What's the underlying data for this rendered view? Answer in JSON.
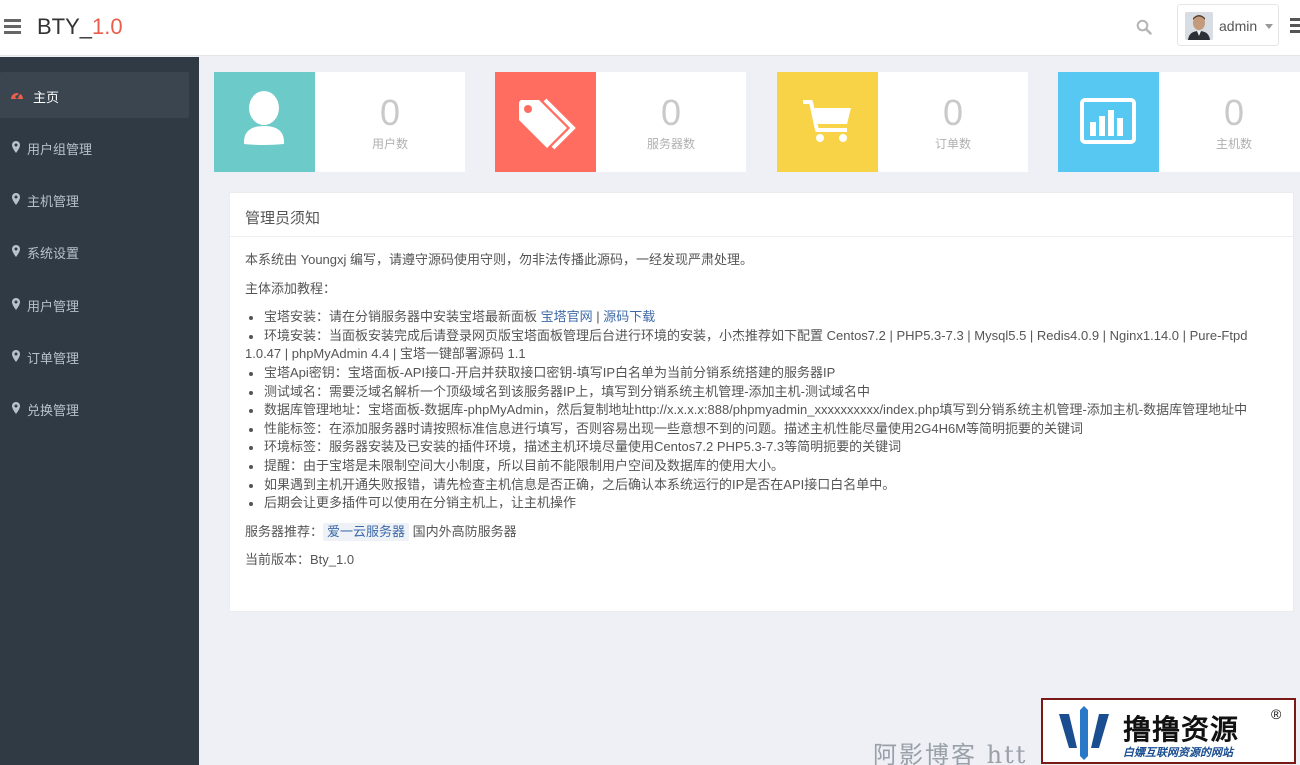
{
  "header": {
    "brand_prefix": "BTY_",
    "brand_version": "1.0",
    "user_name": "admin"
  },
  "sidebar": {
    "items": [
      {
        "label": "主页",
        "icon": "dashboard-icon",
        "active": true
      },
      {
        "label": "用户组管理",
        "icon": "map-marker-icon"
      },
      {
        "label": "主机管理",
        "icon": "map-marker-icon"
      },
      {
        "label": "系统设置",
        "icon": "map-marker-icon"
      },
      {
        "label": "用户管理",
        "icon": "map-marker-icon"
      },
      {
        "label": "订单管理",
        "icon": "map-marker-icon"
      },
      {
        "label": "兑换管理",
        "icon": "map-marker-icon"
      }
    ]
  },
  "stats": [
    {
      "value": "0",
      "label": "用户数",
      "icon": "user-icon",
      "color": "#6ccac9"
    },
    {
      "value": "0",
      "label": "服务器数",
      "icon": "tags-icon",
      "color": "#ff6c60"
    },
    {
      "value": "0",
      "label": "订单数",
      "icon": "shopping-cart-icon",
      "color": "#f8d347"
    },
    {
      "value": "0",
      "label": "主机数",
      "icon": "bar-chart-icon",
      "color": "#57c8f2"
    }
  ],
  "notice": {
    "title": "管理员须知",
    "intro": "本系统由 Youngxj 编写，请遵守源码使用守则，勿非法传播此源码，一经发现严肃处理。",
    "subtitle": "主体添加教程：",
    "item1_text": "宝塔安装：请在分销服务器中安装宝塔最新面板 ",
    "item1_link1": "宝塔官网",
    "item1_sep": " | ",
    "item1_link2": "源码下载",
    "item2": "环境安装：当面板安装完成后请登录网页版宝塔面板管理后台进行环境的安装，小杰推荐如下配置 Centos7.2 | PHP5.3-7.3 | Mysql5.5 | Redis4.0.9 | Nginx1.14.0 | Pure-Ftpd 1.0.47 | phpMyAdmin 4.4 | 宝塔一键部署源码 1.1",
    "item3": "宝塔Api密钥：宝塔面板-API接口-开启并获取接口密钥-填写IP白名单为当前分销系统搭建的服务器IP",
    "item4": "测试域名：需要泛域名解析一个顶级域名到该服务器IP上，填写到分销系统主机管理-添加主机-测试域名中",
    "item5": "数据库管理地址：宝塔面板-数据库-phpMyAdmin，然后复制地址http://x.x.x.x:888/phpmyadmin_xxxxxxxxxx/index.php填写到分销系统主机管理-添加主机-数据库管理地址中",
    "item6": "性能标签：在添加服务器时请按照标准信息进行填写，否则容易出现一些意想不到的问题。描述主机性能尽量使用2G4H6M等简明扼要的关键词",
    "item7": "环境标签：服务器安装及已安装的插件环境，描述主机环境尽量使用Centos7.2 PHP5.3-7.3等简明扼要的关键词",
    "item8": "提醒：由于宝塔是未限制空间大小制度，所以目前不能限制用户空间及数据库的使用大小。",
    "item9": "如果遇到主机开通失败报错，请先检查主机信息是否正确，之后确认本系统运行的IP是否在API接口白名单中。",
    "item10": "后期会让更多插件可以使用在分销主机上，让主机操作",
    "server_label": "服务器推荐：",
    "server_link": "爱一云服务器",
    "server_desc": " 国内外高防服务器",
    "version_label": "当前版本：Bty_1.0"
  },
  "watermark": {
    "blog_text": "阿影博客 htt",
    "logo_title": "撸撸资源",
    "logo_reg": "®",
    "logo_sub": "白嫖互联网资源的网站"
  }
}
